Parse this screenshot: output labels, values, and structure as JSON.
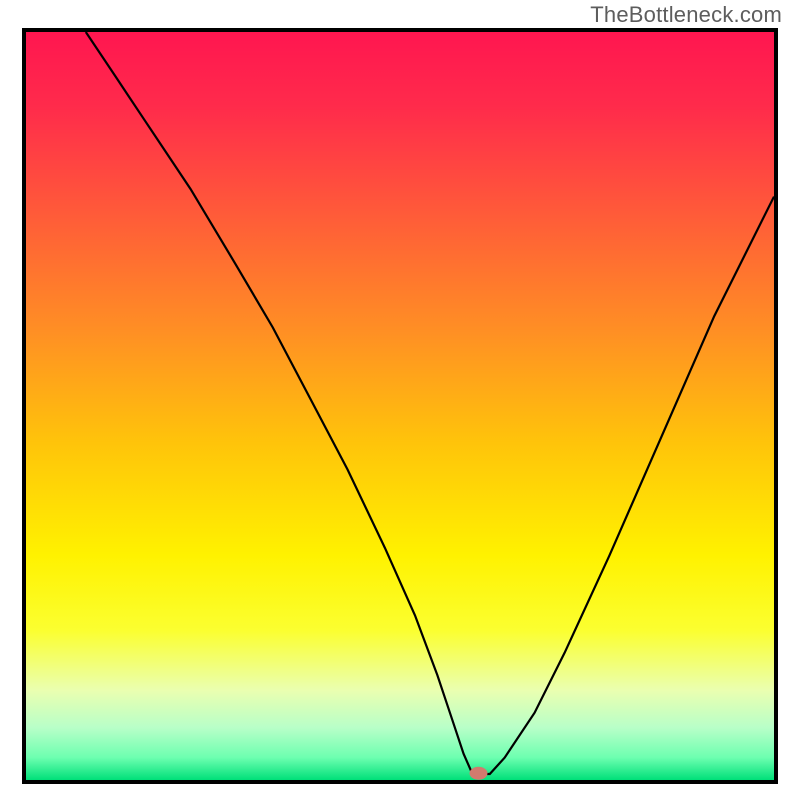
{
  "watermark": "TheBottleneck.com",
  "chart_data": {
    "type": "line",
    "title": "",
    "xlabel": "",
    "ylabel": "",
    "xlim": [
      0,
      100
    ],
    "ylim": [
      0,
      100
    ],
    "grid": false,
    "legend_position": "none",
    "gradient_stops": [
      {
        "offset": 0.0,
        "color": "#ff1650"
      },
      {
        "offset": 0.1,
        "color": "#ff2b4b"
      },
      {
        "offset": 0.25,
        "color": "#ff5d38"
      },
      {
        "offset": 0.4,
        "color": "#ff8f24"
      },
      {
        "offset": 0.55,
        "color": "#ffc40a"
      },
      {
        "offset": 0.7,
        "color": "#fff200"
      },
      {
        "offset": 0.8,
        "color": "#fbff30"
      },
      {
        "offset": 0.88,
        "color": "#eaffb0"
      },
      {
        "offset": 0.93,
        "color": "#b8ffc8"
      },
      {
        "offset": 0.97,
        "color": "#6dffb0"
      },
      {
        "offset": 1.0,
        "color": "#00e079"
      }
    ],
    "series": [
      {
        "name": "bottleneck-curve",
        "x": [
          8,
          12,
          16,
          22,
          28,
          33,
          38,
          43,
          48,
          52,
          55,
          57,
          58.5,
          59.5,
          60,
          62,
          64,
          68,
          72,
          78,
          85,
          92,
          100
        ],
        "y": [
          100,
          94,
          88,
          79,
          69,
          60.5,
          51,
          41.5,
          31,
          22,
          14,
          8,
          3.5,
          1.2,
          0.8,
          0.8,
          3,
          9,
          17,
          30,
          46,
          62,
          78
        ]
      }
    ],
    "marker": {
      "x": 60.5,
      "y": 0.9,
      "color": "#d17a6e"
    }
  }
}
